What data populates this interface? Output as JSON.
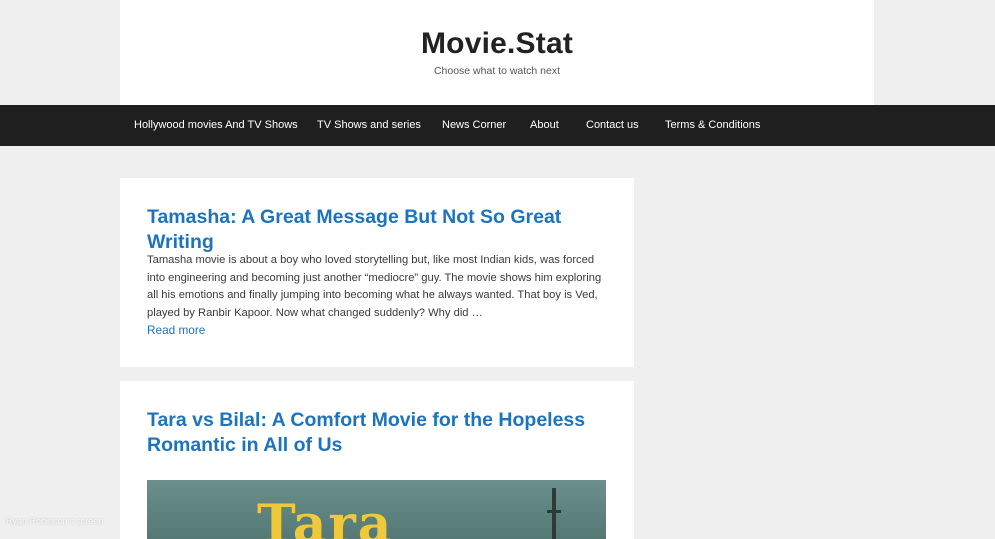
{
  "site": {
    "title": "Movie.Stat",
    "tagline": "Choose what to watch next"
  },
  "nav": {
    "items": [
      "Hollywood movies And TV Shows",
      "TV Shows and series",
      "News Corner",
      "About",
      "Contact us",
      "Terms & Conditions"
    ]
  },
  "posts": [
    {
      "title": "Tamasha: A Great Message But Not So Great Writing",
      "excerpt": "Tamasha movie is about a boy who loved storytelling but, like most Indian kids, was forced into engineering and becoming just another “mediocre” guy. The movie shows him exploring all his emotions and finally jumping into becoming what he always wanted. That boy is Ved, played by Ranbir Kapoor. Now what changed suddenly? Why did …",
      "read_more": "Read more"
    },
    {
      "title": "Tara vs Bilal: A Comfort Movie for the Hopeless Romantic in All of Us",
      "poster_text": "Tara"
    }
  ],
  "overlay": {
    "screen_label": "Ryan Robinson's screen"
  },
  "colors": {
    "background": "#efefef",
    "nav_bg": "#1f1f1f",
    "link": "#1e73be",
    "poster_text": "#f0c93a"
  }
}
